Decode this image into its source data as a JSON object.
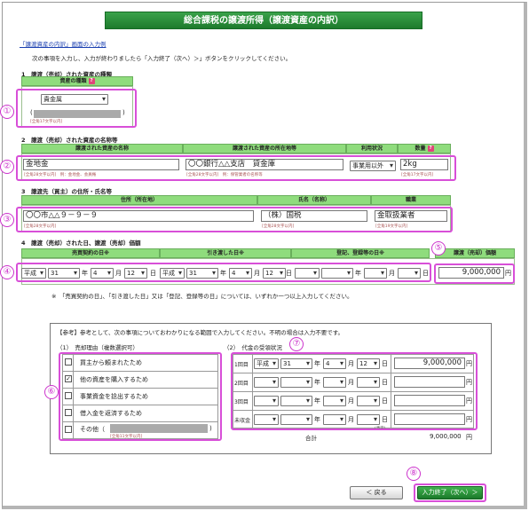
{
  "title": "総合課税の譲渡所得（譲渡資産の内訳）",
  "example_link": "「譲渡資産の内訳」画面の入力例",
  "instruction": "次の事項を入力し、入力が終わりましたら「入力終了（次へ）＞」ボタンをクリックしてください。",
  "sec1": {
    "heading": "1　譲渡（売却）された資産の種類",
    "col_header": "資産の種類",
    "type_value": "貴金属",
    "note": "[全角17文字以内]"
  },
  "sec2": {
    "heading": "2　譲渡（売却）された資産の名称等",
    "headers": [
      "譲渡された資産の名称",
      "譲渡された資産の所在地等",
      "利用状況",
      "数量"
    ],
    "name_value": "金地金",
    "name_note": "[全角28文字以内]　例：金地金、会員権",
    "location_value": "〇〇銀行△△支店　貸金庫",
    "location_note": "[全角28文字以内]　例：保管業者の名称等",
    "usage_value": "事業用以外",
    "qty_value": "2kg",
    "qty_note": "[全角17文字以内]"
  },
  "sec3": {
    "heading": "3　譲渡先（買主）の住所・氏名等",
    "headers": [
      "住所（所在地）",
      "氏名（名称）",
      "職業"
    ],
    "address_value": "〇〇市△△９－９－９",
    "address_note": "[全角28文字以内]",
    "name_value": "（株）国税",
    "name_note": "[全角28文字以内]",
    "job_value": "金取扱業者",
    "job_note": "[全角19文字以内]"
  },
  "sec4": {
    "heading": "4　譲渡（売却）された日、譲渡（売却）価額",
    "headers": [
      "売買契約の日※",
      "引き渡した日※",
      "登記、登録等の日※",
      "譲渡（売却）価額"
    ],
    "contract": {
      "era": "平成",
      "year": "31",
      "month": "4",
      "day": "12"
    },
    "delivery": {
      "era": "平成",
      "year": "31",
      "month": "4",
      "day": "12"
    },
    "registration": {
      "era": "",
      "year": "",
      "month": "",
      "day": ""
    },
    "price": "9,000,000",
    "unit_nen": "年",
    "unit_gatsu": "月",
    "unit_nichi": "日",
    "unit_yen": "円",
    "note": "※　「売買契約の日」、「引き渡した日」又は「登記、登録等の日」については、いずれか一つ以上入力してください。"
  },
  "ref": {
    "intro": "【参考】参考として、次の事項についておわかりになる範囲で入力してください。不明の場合は入力不要です。",
    "reason_heading": "（1）　売却理由（複数選択可）",
    "reasons": [
      {
        "label": "買主から頼まれたため",
        "checked": false
      },
      {
        "label": "他の資産を購入するため",
        "checked": true
      },
      {
        "label": "事業資金を捻出するため",
        "checked": false
      },
      {
        "label": "借入金を返済するため",
        "checked": false
      },
      {
        "label": "その他（",
        "checked": false
      }
    ],
    "other_note": "[全角11文字以内]",
    "payment_heading": "（2）　代金の受領状況",
    "payments": [
      {
        "label": "1回目",
        "era": "平成",
        "year": "31",
        "month": "4",
        "day": "12",
        "amount": "9,000,000"
      },
      {
        "label": "2回目",
        "era": "",
        "year": "",
        "month": "",
        "day": "",
        "amount": ""
      },
      {
        "label": "3回目",
        "era": "",
        "year": "",
        "month": "",
        "day": "",
        "amount": ""
      },
      {
        "label": "未収金",
        "era": "",
        "year": "",
        "month": "",
        "day": "",
        "amount": ""
      }
    ],
    "payment_note": "(予定)",
    "total_label": "合計",
    "total_value": "9,000,000"
  },
  "buttons": {
    "back": "＜ 戻る",
    "next": "入力終了（次へ）＞"
  },
  "markers": [
    "①",
    "②",
    "③",
    "④",
    "⑤",
    "⑥",
    "⑦",
    "⑧"
  ],
  "colors": {
    "title_green": "#1d7a2c",
    "header_green": "#8fdc7d",
    "marker_magenta": "#cc33cc",
    "next_green": "#1b7a2a"
  }
}
